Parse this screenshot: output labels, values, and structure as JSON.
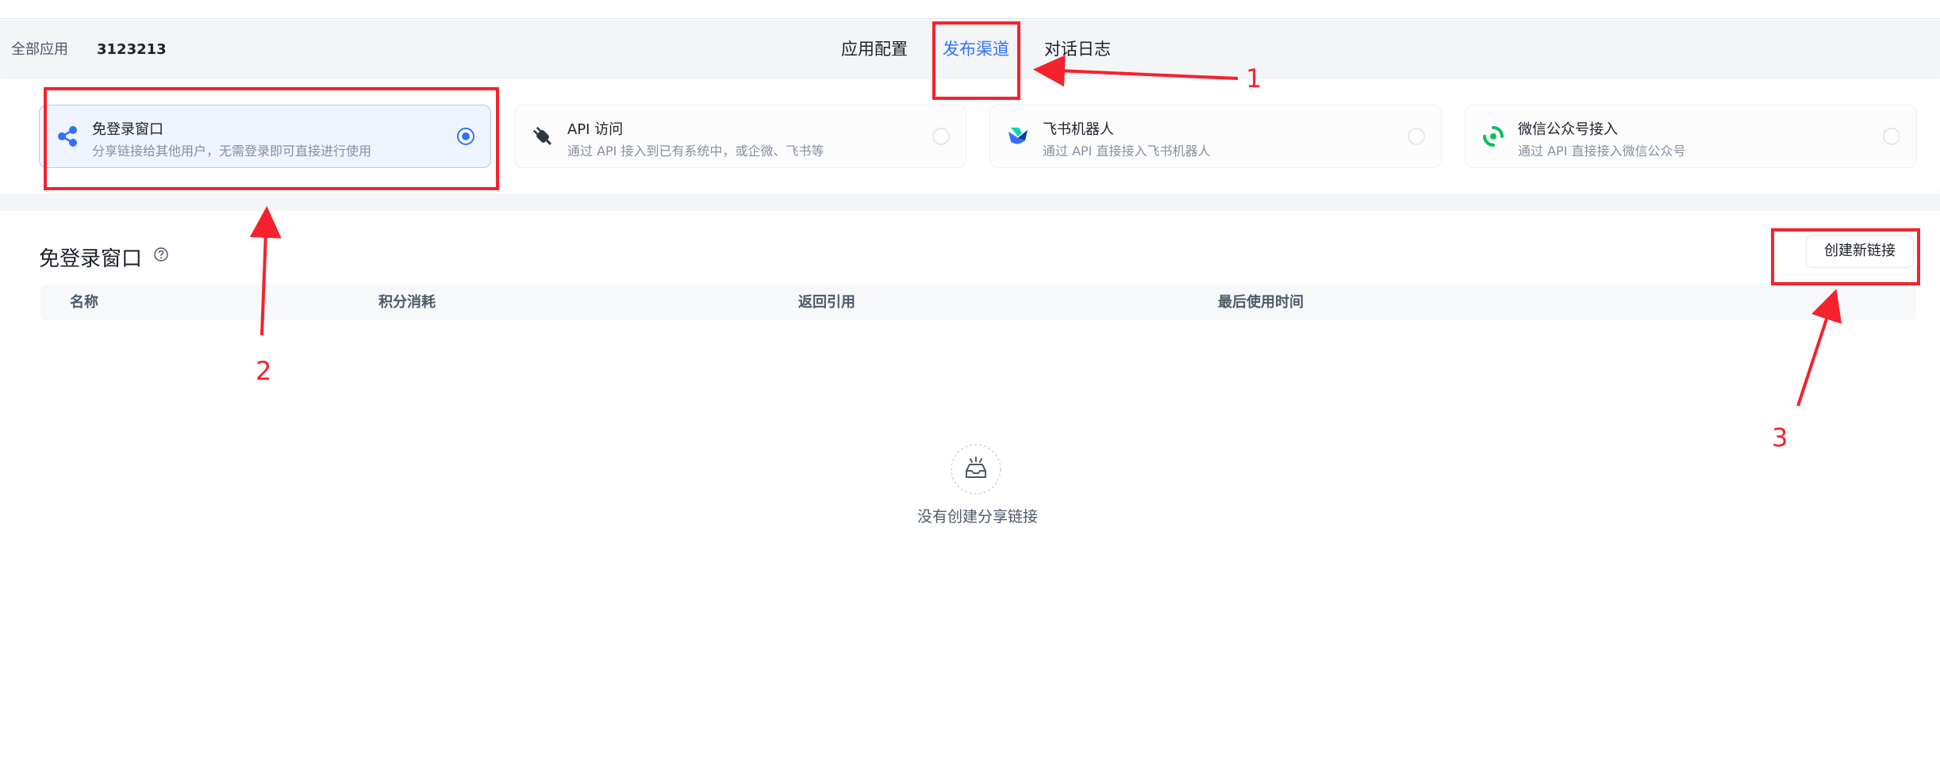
{
  "header": {
    "breadcrumb_root": "全部应用",
    "app_name": "3123213",
    "tabs": [
      {
        "label": "应用配置",
        "active": false
      },
      {
        "label": "发布渠道",
        "active": true
      },
      {
        "label": "对话日志",
        "active": false
      }
    ]
  },
  "channels": [
    {
      "title": "免登录窗口",
      "desc": "分享链接给其他用户，无需登录即可直接进行使用",
      "icon": "share-icon",
      "selected": true
    },
    {
      "title": "API 访问",
      "desc": "通过 API 接入到已有系统中，或企微、飞书等",
      "icon": "plug-icon",
      "selected": false
    },
    {
      "title": "飞书机器人",
      "desc": "通过 API 直接接入飞书机器人",
      "icon": "feishu-icon",
      "selected": false
    },
    {
      "title": "微信公众号接入",
      "desc": "通过 API 直接接入微信公众号",
      "icon": "wechat-icon",
      "selected": false
    }
  ],
  "section": {
    "title": "免登录窗口",
    "create_button": "创建新链接"
  },
  "table": {
    "columns": [
      "名称",
      "积分消耗",
      "返回引用",
      "最后使用时间"
    ]
  },
  "empty": {
    "text": "没有创建分享链接"
  },
  "annotations": [
    "1",
    "2",
    "3"
  ],
  "colors": {
    "accent": "#3370ff",
    "annotation": "#f5222d",
    "header_bg": "#f4f5f7"
  }
}
